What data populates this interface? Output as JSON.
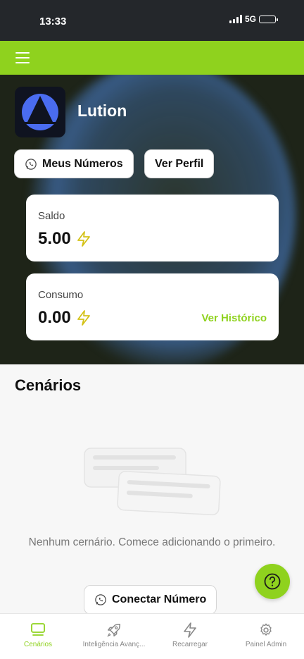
{
  "status_bar": {
    "time": "13:33",
    "network": "5G"
  },
  "brand": {
    "name": "Lution"
  },
  "buttons": {
    "my_numbers": "Meus Números",
    "view_profile": "Ver Perfil",
    "connect_number": "Conectar Número"
  },
  "balance": {
    "label": "Saldo",
    "value": "5.00"
  },
  "consumption": {
    "label": "Consumo",
    "value": "0.00",
    "history_link": "Ver Histórico"
  },
  "scenarios": {
    "title": "Cenários",
    "empty_message": "Nenhum cernário. Comece adicionando o primeiro."
  },
  "nav": [
    {
      "label": "Cenários",
      "icon": "monitor-icon",
      "active": true
    },
    {
      "label": "Inteligência Avanç...",
      "icon": "rocket-icon",
      "active": false
    },
    {
      "label": "Recarregar",
      "icon": "lightning-icon",
      "active": false
    },
    {
      "label": "Painel Admin",
      "icon": "gear-icon",
      "active": false
    }
  ],
  "colors": {
    "accent": "#8fd21e",
    "hero_bg": "#1e2418",
    "status_bar": "#24272b",
    "lightning": "#d4c218"
  }
}
